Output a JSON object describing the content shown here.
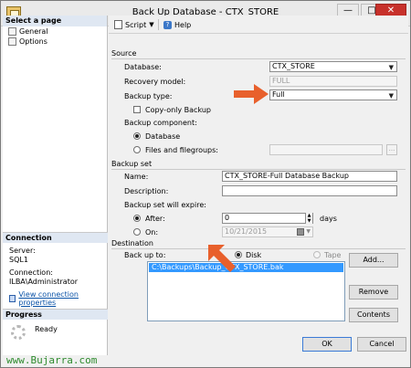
{
  "window": {
    "title": "Back Up Database - CTX_STORE",
    "controls": [
      "—",
      "□",
      "✕"
    ]
  },
  "left": {
    "select_page_title": "Select a page",
    "pages": [
      {
        "label": "General",
        "icon": "page-icon"
      },
      {
        "label": "Options",
        "icon": "page-icon"
      }
    ],
    "connection_title": "Connection",
    "server_label": "Server:",
    "server_value": "SQL1",
    "connection_label": "Connection:",
    "connection_value": "ILBA\\Administrator",
    "view_connection_properties": "View connection properties",
    "progress_title": "Progress",
    "progress_status": "Ready"
  },
  "toolbar": {
    "script_label": "Script",
    "help_label": "Help"
  },
  "source": {
    "section_title": "Source",
    "database_label": "Database:",
    "database_value": "CTX_STORE",
    "recovery_model_label": "Recovery model:",
    "recovery_model_value": "FULL",
    "backup_type_label": "Backup type:",
    "backup_type_value": "Full",
    "copy_only_label": "Copy-only Backup",
    "backup_component_label": "Backup component:",
    "component_database_label": "Database",
    "component_files_label": "Files and filegroups:",
    "browse_label": "..."
  },
  "backup_set": {
    "section_title": "Backup set",
    "name_label": "Name:",
    "name_value": "CTX_STORE-Full Database Backup",
    "description_label": "Description:",
    "description_value": "",
    "expire_label": "Backup set will expire:",
    "after_label": "After:",
    "after_value": "0",
    "days_label": "days",
    "on_label": "On:",
    "on_value": "10/21/2015"
  },
  "destination": {
    "section_title": "Destination",
    "back_up_to_label": "Back up to:",
    "disk_label": "Disk",
    "tape_label": "Tape",
    "paths": [
      "C:\\Backups\\Backup_CTX_STORE.bak"
    ],
    "add_label": "Add...",
    "remove_label": "Remove",
    "contents_label": "Contents"
  },
  "footer": {
    "ok_label": "OK",
    "cancel_label": "Cancel"
  },
  "watermark": "www.Bujarra.com",
  "colors": {
    "accent_arrow": "#e8602c",
    "selection": "#3399ff",
    "close_button": "#c7312b",
    "watermark": "#2e8b2e"
  }
}
